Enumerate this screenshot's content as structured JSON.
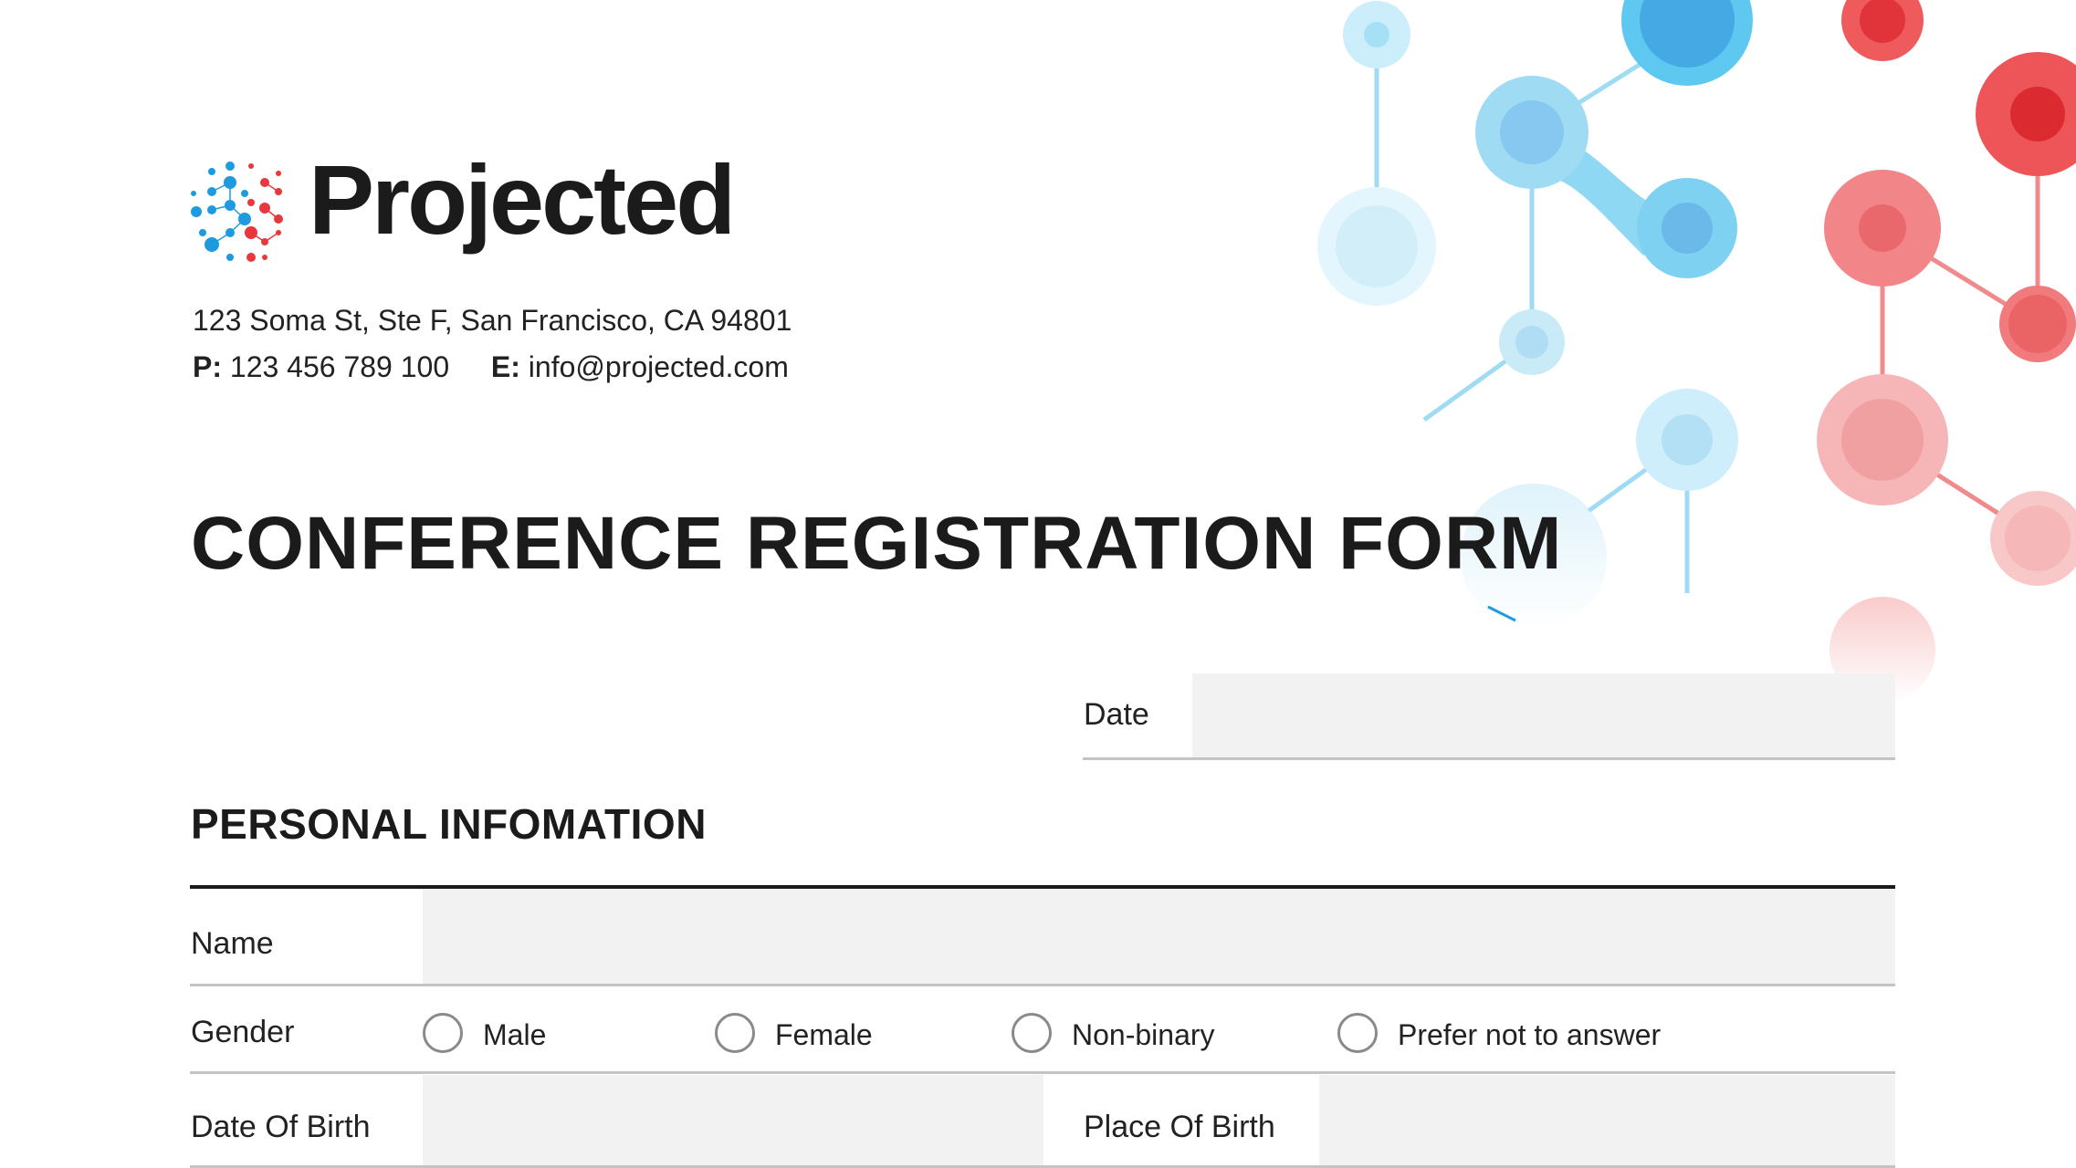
{
  "brand": {
    "name": "Projected",
    "address": "123 Soma St, Ste F, San Francisco, CA 94801",
    "phone_label": "P:",
    "phone": "123 456 789 100",
    "email_label": "E:",
    "email": "info@projected.com"
  },
  "form": {
    "title": "CONFERENCE REGISTRATION FORM",
    "date_label": "Date",
    "date_value": ""
  },
  "personal": {
    "heading": "PERSONAL INFOMATION",
    "name_label": "Name",
    "name_value": "",
    "gender_label": "Gender",
    "gender_options": [
      "Male",
      "Female",
      "Non-binary",
      "Prefer not to answer"
    ],
    "dob_label": "Date Of Birth",
    "dob_value": "",
    "pob_label": "Place Of Birth",
    "pob_value": ""
  },
  "colors": {
    "blue": "#1e9be0",
    "light_blue": "#8fd3f0",
    "red": "#e8383d",
    "light_red": "#f39a9c",
    "field_bg": "#f2f2f2"
  }
}
